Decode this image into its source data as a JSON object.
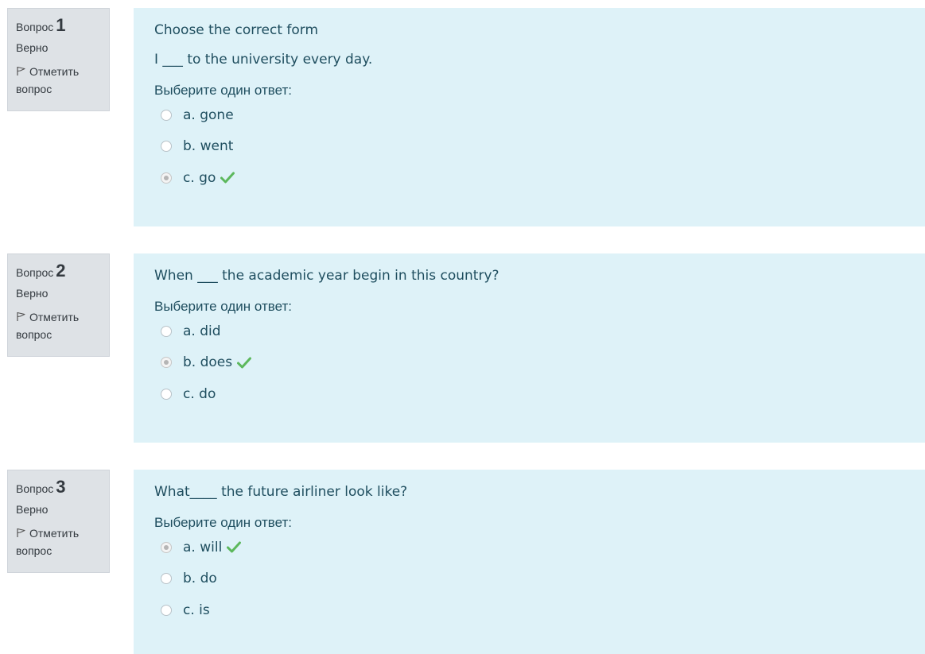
{
  "questions": [
    {
      "label": "Вопрос",
      "number": "1",
      "state": "Верно",
      "flag_label": "Отметить вопрос",
      "text": [
        "Choose the correct form",
        "I ___ to the university every day."
      ],
      "prompt": "Выберите один ответ:",
      "answers": [
        {
          "label": "a. gone",
          "selected": false,
          "correct": false
        },
        {
          "label": "b. went",
          "selected": false,
          "correct": false
        },
        {
          "label": "c. go",
          "selected": true,
          "correct": true
        }
      ]
    },
    {
      "label": "Вопрос",
      "number": "2",
      "state": "Верно",
      "flag_label": "Отметить вопрос",
      "text": [
        "When ___ the academic year begin in this country?"
      ],
      "prompt": "Выберите один ответ:",
      "answers": [
        {
          "label": "a. did",
          "selected": false,
          "correct": false
        },
        {
          "label": "b. does",
          "selected": true,
          "correct": true
        },
        {
          "label": "c. do",
          "selected": false,
          "correct": false
        }
      ]
    },
    {
      "label": "Вопрос",
      "number": "3",
      "state": "Верно",
      "flag_label": "Отметить вопрос",
      "text": [
        "What____ the future airliner look like?"
      ],
      "prompt": "Выберите один ответ:",
      "answers": [
        {
          "label": "a. will",
          "selected": true,
          "correct": true
        },
        {
          "label": "b. do",
          "selected": false,
          "correct": false
        },
        {
          "label": "c. is",
          "selected": false,
          "correct": false
        }
      ]
    }
  ],
  "colors": {
    "content_bg": "#def2f8",
    "info_bg": "#dee2e6",
    "text": "#1f4e5f",
    "correct_check": "#5cb85c"
  },
  "icons": {
    "flag": "flag-icon",
    "correct": "check-icon"
  }
}
